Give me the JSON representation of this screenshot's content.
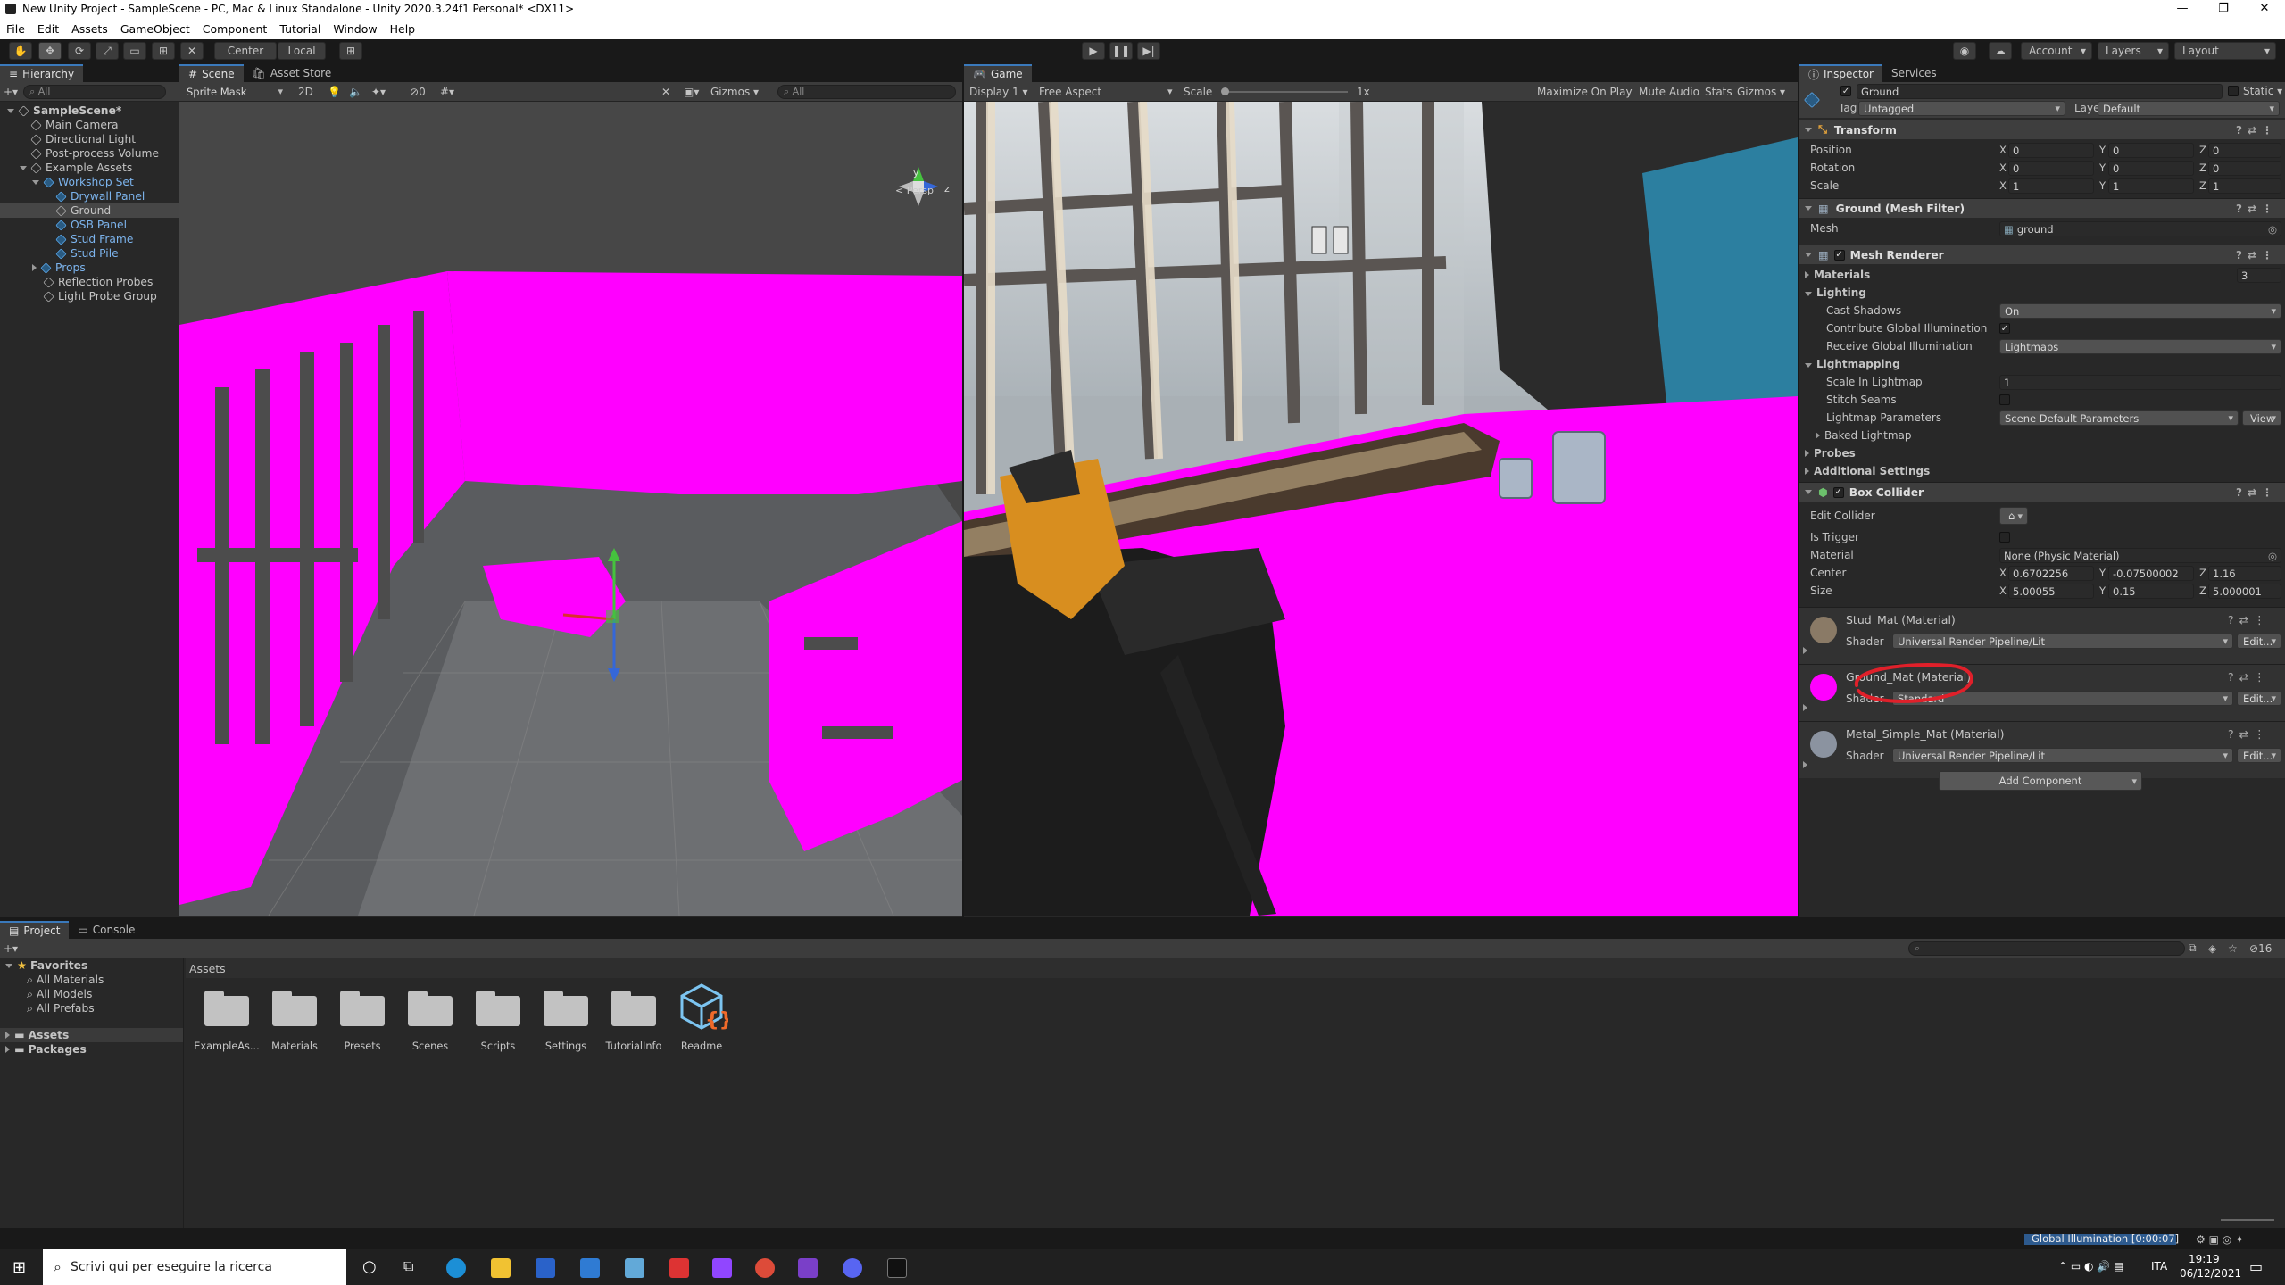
{
  "window": {
    "title": "New Unity Project - SampleScene - PC, Mac & Linux Standalone - Unity 2020.3.24f1 Personal* <DX11>"
  },
  "menu": [
    "File",
    "Edit",
    "Assets",
    "GameObject",
    "Component",
    "Tutorial",
    "Window",
    "Help"
  ],
  "toolbar": {
    "center": "Center",
    "local": "Local",
    "account": "Account",
    "layers": "Layers",
    "layout": "Layout"
  },
  "hierarchy": {
    "tab": "Hierarchy",
    "search_placeholder": "All",
    "items": [
      {
        "label": "SampleScene*",
        "depth": 0,
        "type": "scene"
      },
      {
        "label": "Main Camera",
        "depth": 1,
        "type": "obj"
      },
      {
        "label": "Directional Light",
        "depth": 1,
        "type": "obj"
      },
      {
        "label": "Post-process Volume",
        "depth": 1,
        "type": "obj"
      },
      {
        "label": "Example Assets",
        "depth": 1,
        "type": "obj"
      },
      {
        "label": "Workshop Set",
        "depth": 2,
        "type": "prefab"
      },
      {
        "label": "Drywall Panel",
        "depth": 3,
        "type": "prefab"
      },
      {
        "label": "Ground",
        "depth": 3,
        "type": "selected"
      },
      {
        "label": "OSB Panel",
        "depth": 3,
        "type": "prefab"
      },
      {
        "label": "Stud Frame",
        "depth": 3,
        "type": "prefab"
      },
      {
        "label": "Stud Pile",
        "depth": 3,
        "type": "prefab"
      },
      {
        "label": "Props",
        "depth": 2,
        "type": "prefab"
      },
      {
        "label": "Reflection Probes",
        "depth": 2,
        "type": "obj"
      },
      {
        "label": "Light Probe Group",
        "depth": 2,
        "type": "obj"
      }
    ]
  },
  "scene": {
    "tab_scene": "Scene",
    "tab_store": "Asset Store",
    "draw_mode": "Sprite Mask",
    "mode_2d": "2D",
    "hidden_count": "0",
    "gizmos": "Gizmos",
    "search_placeholder": "All",
    "persp": "< Persp",
    "axis_y": "y",
    "axis_z": "z"
  },
  "game": {
    "tab": "Game",
    "display": "Display 1",
    "aspect": "Free Aspect",
    "scale_label": "Scale",
    "scale_value": "1x",
    "maximize": "Maximize On Play",
    "mute": "Mute Audio",
    "stats": "Stats",
    "gizmos": "Gizmos"
  },
  "inspector": {
    "tab": "Inspector",
    "tab_services": "Services",
    "object_name": "Ground",
    "static_label": "Static",
    "tag_label": "Tag",
    "tag_value": "Untagged",
    "layer_label": "Layer",
    "layer_value": "Default",
    "transform": {
      "title": "Transform",
      "position_label": "Position",
      "position": [
        "0",
        "0",
        "0"
      ],
      "rotation_label": "Rotation",
      "rotation": [
        "0",
        "0",
        "0"
      ],
      "scale_label": "Scale",
      "scale": [
        "1",
        "1",
        "1"
      ]
    },
    "mesh_filter": {
      "title": "Ground (Mesh Filter)",
      "mesh_label": "Mesh",
      "mesh_value": "ground"
    },
    "mesh_renderer": {
      "title": "Mesh Renderer",
      "materials_label": "Materials",
      "materials_count": "3",
      "lighting_label": "Lighting",
      "cast_shadows_label": "Cast Shadows",
      "cast_shadows": "On",
      "contribute_gi_label": "Contribute Global Illumination",
      "receive_gi_label": "Receive Global Illumination",
      "receive_gi": "Lightmaps",
      "lightmapping_label": "Lightmapping",
      "scale_lightmap_label": "Scale In Lightmap",
      "scale_lightmap": "1",
      "stitch_label": "Stitch Seams",
      "lm_params_label": "Lightmap Parameters",
      "lm_params": "Scene Default Parameters",
      "view_label": "View",
      "baked_label": "Baked Lightmap",
      "probes_label": "Probes",
      "additional_label": "Additional Settings"
    },
    "box_collider": {
      "title": "Box Collider",
      "edit_label": "Edit Collider",
      "trigger_label": "Is Trigger",
      "material_label": "Material",
      "material_value": "None (Physic Material)",
      "center_label": "Center",
      "center": [
        "0.6702256",
        "-0.07500002",
        "1.16"
      ],
      "size_label": "Size",
      "size": [
        "5.00055",
        "0.15",
        "5.000001"
      ]
    },
    "materials": [
      {
        "name": "Stud_Mat (Material)",
        "shader_label": "Shader",
        "shader": "Universal Render Pipeline/Lit",
        "edit": "Edit...",
        "color": "#8a7a66"
      },
      {
        "name": "Ground_Mat (Material)",
        "shader_label": "Shader",
        "shader": "Standard",
        "edit": "Edit...",
        "color": "#ff00ff"
      },
      {
        "name": "Metal_Simple_Mat (Material)",
        "shader_label": "Shader",
        "shader": "Universal Render Pipeline/Lit",
        "edit": "Edit...",
        "color": "#8b93a0"
      }
    ],
    "add_component": "Add Component"
  },
  "project": {
    "tab_project": "Project",
    "tab_console": "Console",
    "favorites_label": "Favorites",
    "favorites": [
      "All Materials",
      "All Models",
      "All Prefabs"
    ],
    "assets_label": "Assets",
    "packages_label": "Packages",
    "breadcrumb": "Assets",
    "folders": [
      "ExampleAs...",
      "Materials",
      "Presets",
      "Scenes",
      "Scripts",
      "Settings",
      "TutorialInfo",
      "Readme"
    ],
    "hidden_count": "16"
  },
  "status": {
    "gi": "Global Illumination [0:00:07]"
  },
  "taskbar": {
    "search_placeholder": "Scrivi qui per eseguire la ricerca",
    "lang": "ITA",
    "time": "19:19",
    "date": "06/12/2021"
  },
  "colors": {
    "magenta": "#ff00ff",
    "annotation": "#e0202a",
    "accent": "#3a79bb"
  }
}
